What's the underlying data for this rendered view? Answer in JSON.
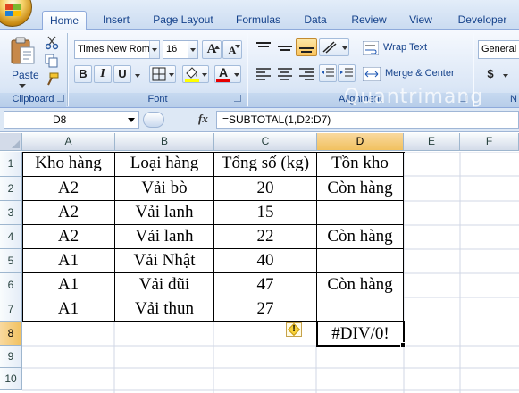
{
  "tabs": [
    {
      "label": "Home",
      "active": true
    },
    {
      "label": "Insert"
    },
    {
      "label": "Page Layout"
    },
    {
      "label": "Formulas"
    },
    {
      "label": "Data"
    },
    {
      "label": "Review"
    },
    {
      "label": "View"
    },
    {
      "label": "Developer"
    }
  ],
  "ribbon": {
    "clipboard": {
      "paste_label": "Paste",
      "group_label": "Clipboard"
    },
    "font": {
      "font_name": "Times New Rom",
      "font_size": "16",
      "group_label": "Font",
      "bold": "B",
      "italic": "I",
      "underline": "U",
      "grow": "A",
      "shrink": "A",
      "font_color_letter": "A"
    },
    "alignment": {
      "wrap_text": "Wrap Text",
      "merge_center": "Merge & Center",
      "group_label": "Alignment"
    },
    "number": {
      "format": "General",
      "currency": "$",
      "group_label": "N"
    }
  },
  "formula_bar": {
    "name_box": "D8",
    "fx": "fx",
    "formula": "=SUBTOTAL(1,D2:D7)"
  },
  "grid": {
    "columns": [
      "A",
      "B",
      "C",
      "D",
      "E",
      "F"
    ],
    "rows": [
      "1",
      "2",
      "3",
      "4",
      "5",
      "6",
      "7",
      "8",
      "9",
      "10"
    ],
    "cells": [
      [
        "Kho hàng",
        "Loại hàng",
        "Tổng số (kg)",
        "Tồn kho"
      ],
      [
        "A2",
        "Vải bò",
        "20",
        "Còn hàng"
      ],
      [
        "A2",
        "Vải lanh",
        "15",
        ""
      ],
      [
        "A2",
        "Vải lanh",
        "22",
        "Còn hàng"
      ],
      [
        "A1",
        "Vải Nhật",
        "40",
        ""
      ],
      [
        "A1",
        "Vải đũi",
        "47",
        "Còn hàng"
      ],
      [
        "A1",
        "Vải thun",
        "27",
        ""
      ]
    ],
    "d8_value": "#DIV/0!",
    "selected_cell": "D8"
  },
  "watermark": "Quantrimang",
  "colors": {
    "accent": "#15428b",
    "selection": "#f1c15f",
    "ribbon": "#dae6f6"
  }
}
